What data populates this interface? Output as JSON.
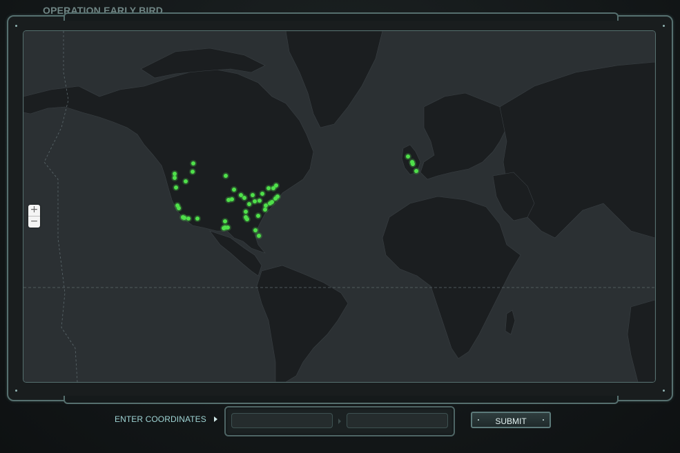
{
  "app": {
    "title": "OPERATION EARLY BIRD"
  },
  "map": {
    "zoom_in_label": "+",
    "zoom_out_label": "−",
    "marker_color": "#4fe04a",
    "land_color": "#1a1d1f",
    "ocean_color": "#2b3033",
    "marker_regions": [
      "Western United States",
      "Central United States",
      "Eastern United States",
      "Florida",
      "Texas",
      "United Kingdom",
      "Ireland"
    ]
  },
  "coordinates": {
    "label": "ENTER COORDINATES",
    "lat_value": "",
    "lng_value": "",
    "submit_label": "SUBMIT"
  },
  "colors": {
    "accent": "#9fd4d4",
    "frame": "#56706f",
    "background": "#141819"
  }
}
